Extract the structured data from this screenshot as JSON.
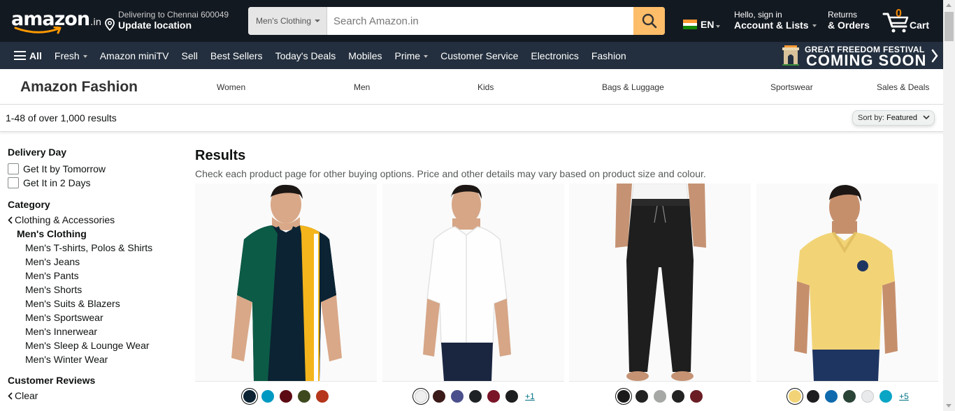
{
  "header": {
    "logo": "amazon",
    "logo_suffix": ".in",
    "location_line1": "Delivering to Chennai 600049",
    "location_line2": "Update location",
    "search_category": "Men's Clothing",
    "search_placeholder": "Search Amazon.in",
    "language": "EN",
    "account_line1": "Hello, sign in",
    "account_line2": "Account & Lists",
    "returns_line1": "Returns",
    "returns_line2": "& Orders",
    "cart_count": "0",
    "cart_label": "Cart"
  },
  "nav": {
    "all": "All",
    "items": [
      "Fresh",
      "Amazon miniTV",
      "Sell",
      "Best Sellers",
      "Today's Deals",
      "Mobiles",
      "Prime",
      "Customer Service",
      "Electronics",
      "Fashion"
    ],
    "promo_line1": "GREAT FREEDOM FESTIVAL",
    "promo_line2": "COMING SOON"
  },
  "subnav": {
    "brand": "Amazon Fashion",
    "links": [
      "Women",
      "Men",
      "Kids",
      "Bags & Luggage",
      "Sportswear",
      "Sales & Deals"
    ]
  },
  "results_bar": {
    "count": "1-48 of over 1,000 results",
    "sort_label": "Sort by:",
    "sort_value": "Featured"
  },
  "sidebar": {
    "delivery_heading": "Delivery Day",
    "delivery_options": [
      "Get It by Tomorrow",
      "Get It in 2 Days"
    ],
    "category_heading": "Category",
    "category_back": "Clothing & Accessories",
    "category_current": "Men's Clothing",
    "subcategories": [
      "Men's T-shirts, Polos & Shirts",
      "Men's Jeans",
      "Men's Pants",
      "Men's Shorts",
      "Men's Suits & Blazers",
      "Men's Sportswear",
      "Men's Innerwear",
      "Men's Sleep & Lounge Wear",
      "Men's Winter Wear"
    ],
    "reviews_heading": "Customer Reviews",
    "reviews_clear": "Clear"
  },
  "results": {
    "title": "Results",
    "subtitle": "Check each product page for other buying options. Price and other details may vary based on product size and colour."
  },
  "products": [
    {
      "image": "green-navy-yellow-polo",
      "swatches": [
        "#0b2333",
        "#0099c2",
        "#5c0a13",
        "#3e4a1e",
        "#b5361c"
      ],
      "selected": 0,
      "more": ""
    },
    {
      "image": "white-shirt",
      "swatches": [
        "#efefef",
        "#3b1a1a",
        "#4b4f8c",
        "#1f2224",
        "#7a1528",
        "#1d1e20"
      ],
      "selected": 0,
      "more": "+1"
    },
    {
      "image": "black-track-pants",
      "swatches": [
        "#1a1a1a",
        "#222222",
        "#a6a8a6",
        "#222222",
        "#6a1e24"
      ],
      "selected": 0,
      "more": ""
    },
    {
      "image": "yellow-polo",
      "swatches": [
        "#f2d477",
        "#1d1d1f",
        "#0e6aad",
        "#2b4438",
        "#e9eaec",
        "#0aa5c5"
      ],
      "selected": 0,
      "more": "+5"
    }
  ]
}
